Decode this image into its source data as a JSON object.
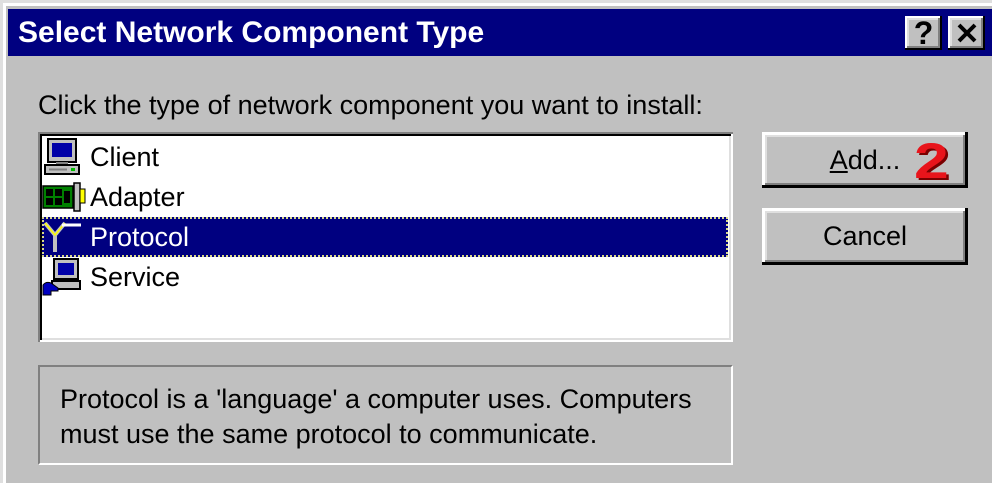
{
  "window": {
    "title": "Select Network Component Type",
    "help_button_label": "?",
    "close_icon": "close-icon"
  },
  "prompt": "Click the type of network component you want to install:",
  "components": [
    {
      "label": "Client",
      "icon": "client-computer-icon",
      "selected": false
    },
    {
      "label": "Adapter",
      "icon": "network-adapter-icon",
      "selected": false
    },
    {
      "label": "Protocol",
      "icon": "protocol-icon",
      "selected": true
    },
    {
      "label": "Service",
      "icon": "service-icon",
      "selected": false
    }
  ],
  "buttons": {
    "add": "Add...",
    "cancel": "Cancel"
  },
  "annotation": "2",
  "description": [
    "Protocol is a 'language' a computer uses. Computers",
    "must use the same protocol to communicate."
  ],
  "colors": {
    "title_bar": "#000080",
    "dialog_face": "#c0c0c0",
    "selection": "#000080",
    "annotation": "#e8141b"
  }
}
